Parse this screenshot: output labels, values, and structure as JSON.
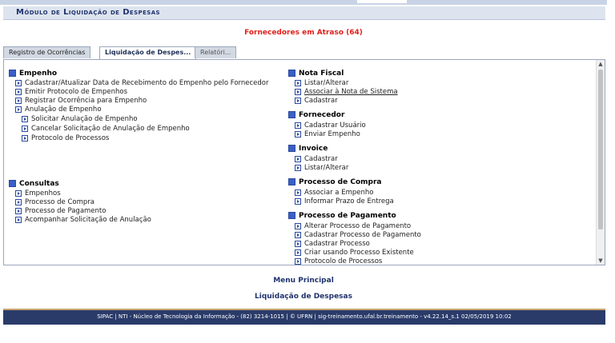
{
  "header": {
    "title": "Módulo de Liquidação de Despesas"
  },
  "alert": {
    "text": "Fornecedores em Atraso (64)"
  },
  "tabs": [
    "Registro de Ocorrências",
    "Liquidação de Despes...",
    "Relatóri..."
  ],
  "left": {
    "empenho": {
      "title": "Empenho",
      "items": [
        "Cadastrar/Atualizar Data de Recebimento do Empenho pelo Fornecedor",
        "Emitir Protocolo de Empenhos",
        "Registrar Ocorrência para Empenho",
        "Anulação de Empenho"
      ],
      "sub": [
        "Solicitar Anulação de Empenho",
        "Cancelar Solicitação de Anulação de Empenho",
        "Protocolo de Processos"
      ]
    },
    "consultas": {
      "title": "Consultas",
      "items": [
        "Empenhos",
        "Processo de Compra",
        "Processo de Pagamento",
        "Acompanhar Solicitação de Anulação"
      ]
    }
  },
  "right": {
    "nota_fiscal": {
      "title": "Nota Fiscal",
      "items": [
        "Listar/Alterar",
        "Associar à Nota de Sistema",
        "Cadastrar"
      ]
    },
    "fornecedor": {
      "title": "Fornecedor",
      "items": [
        "Cadastrar Usuário",
        "Enviar Empenho"
      ]
    },
    "invoice": {
      "title": "Invoice",
      "items": [
        "Cadastrar",
        "Listar/Alterar"
      ]
    },
    "processo_compra": {
      "title": "Processo de Compra",
      "items": [
        "Associar a Empenho",
        "Informar Prazo de Entrega"
      ]
    },
    "processo_pagamento": {
      "title": "Processo de Pagamento",
      "items": [
        "Alterar Processo de Pagamento",
        "Cadastrar Processo de Pagamento",
        "Cadastrar Processo",
        "Criar usando Processo Existente",
        "Protocolo de Processos"
      ]
    }
  },
  "footer": {
    "menu_principal": "Menu Principal",
    "liquidacao": "Liquidação de Despesas",
    "bar": "SIPAC | NTI - Núcleo de Tecnologia da Informação - (82) 3214-1015 | © UFRN | sig-treinamento.ufal.br.treinamento - v4.22.14_s.1 02/05/2019 10:02"
  }
}
